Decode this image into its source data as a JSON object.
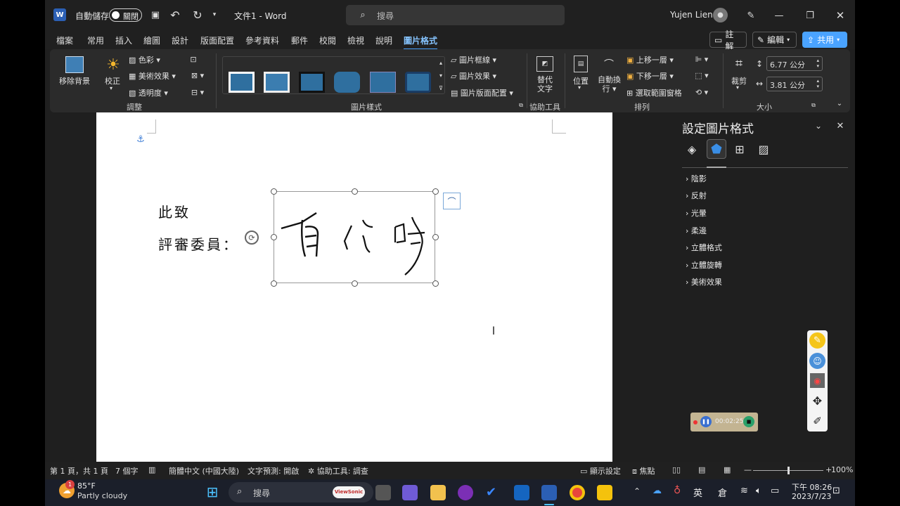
{
  "titlebar": {
    "autosave_label": "自動儲存",
    "autosave_state": "關閉",
    "doc_title": "文件1 - Word",
    "search_placeholder": "搜尋",
    "user_name": "Yujen Lien"
  },
  "menu": {
    "tabs": [
      "檔案",
      "常用",
      "插入",
      "繪圖",
      "設計",
      "版面配置",
      "參考資料",
      "郵件",
      "校閱",
      "檢視",
      "說明",
      "圖片格式"
    ],
    "active": "圖片格式",
    "comments": "註解",
    "editing": "編輯",
    "share": "共用"
  },
  "ribbon": {
    "remove_bg": "移除背景",
    "corrections": "校正",
    "color": "色彩",
    "artistic": "美術效果",
    "transparency": "透明度",
    "group_adjust": "調整",
    "group_styles": "圖片樣式",
    "border": "圖片框線",
    "effects": "圖片效果",
    "layout": "圖片版面配置",
    "alt_text_1": "替代",
    "alt_text_2": "文字",
    "group_access": "協助工具",
    "position": "位置",
    "wrap_1": "自動換",
    "wrap_2": "行",
    "forward": "上移一層",
    "backward": "下移一層",
    "selection_pane": "選取範圍窗格",
    "group_arrange": "排列",
    "crop": "裁剪",
    "height": "6.77 公分",
    "width": "3.81 公分",
    "group_size": "大小"
  },
  "document": {
    "line1": "此致",
    "line2": "評審委員："
  },
  "pane": {
    "title": "設定圖片格式",
    "sections": [
      "陰影",
      "反射",
      "光暈",
      "柔邊",
      "立體格式",
      "立體旋轉",
      "美術效果"
    ]
  },
  "status": {
    "page": "第 1 頁，共 1 頁",
    "words": "7 個字",
    "language": "簡體中文 (中國大陸)",
    "prediction": "文字預測: 開啟",
    "accessibility": "協助工具: 調查",
    "display": "顯示設定",
    "focus": "焦點",
    "zoom": "100%",
    "zoom_fraction": 0.5
  },
  "recorder": {
    "time": "00:02:25"
  },
  "taskbar": {
    "temp": "85°F",
    "weather": "Partly cloudy",
    "badge": "1",
    "search": "搜尋",
    "ime": "英",
    "ime2": "倉",
    "time": "下午 08:26",
    "date": "2023/7/23",
    "viewsonic": "ViewSonic"
  },
  "colors": {
    "accent": "#4aa3ff",
    "ribbon_bg": "#2b2b2b",
    "frame_bg": "#1f1f1f"
  }
}
